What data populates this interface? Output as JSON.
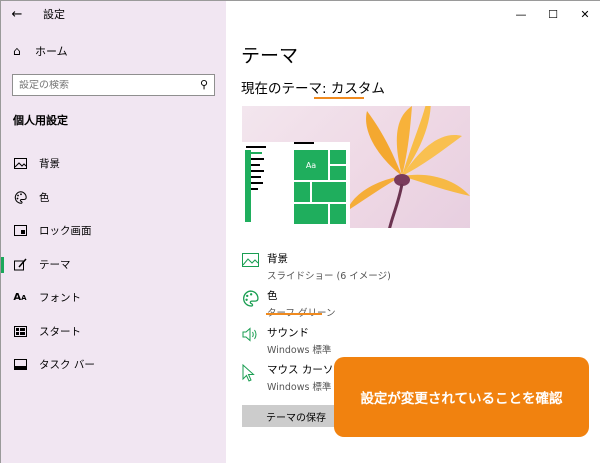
{
  "window": {
    "title": "設定"
  },
  "left": {
    "back_label": "←",
    "home_label": "ホーム",
    "search_placeholder": "設定の検索",
    "section_title": "個人用設定",
    "items": [
      {
        "label": "背景"
      },
      {
        "label": "色"
      },
      {
        "label": "ロック画面"
      },
      {
        "label": "テーマ"
      },
      {
        "label": "フォント"
      },
      {
        "label": "スタート"
      },
      {
        "label": "タスク バー"
      }
    ]
  },
  "main": {
    "title": "テーマ",
    "current_theme": "現在のテーマ: カスタム",
    "preview_tile_text": "Aa",
    "settings": [
      {
        "name": "背景",
        "value": "スライドショー (6 イメージ)"
      },
      {
        "name": "色",
        "value": "ターフ グリーン"
      },
      {
        "name": "サウンド",
        "value": "Windows 標準"
      },
      {
        "name": "マウス カーソル",
        "value": "Windows 標準"
      }
    ],
    "save_button": "テーマの保存"
  },
  "callout": {
    "text": "設定が変更されていることを確認"
  },
  "colors": {
    "accent": "#1aa85b",
    "highlight": "#f08a1e",
    "sidebar_bg": "#f1e6f2"
  }
}
